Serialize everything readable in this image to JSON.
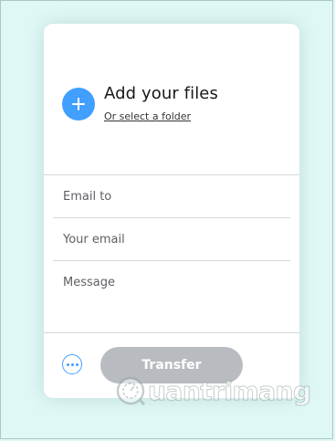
{
  "upload": {
    "title": "Add your files",
    "folder_link": "Or select a folder"
  },
  "form": {
    "email_to_placeholder": "Email to",
    "your_email_placeholder": "Your email",
    "message_placeholder": "Message"
  },
  "actions": {
    "more_icon": "more-options-icon",
    "transfer_label": "Transfer"
  },
  "watermark": {
    "text": "uantrimang"
  },
  "colors": {
    "accent": "#409fff",
    "disabled_button": "#b8bcc0",
    "background": "#e0f8f5"
  }
}
